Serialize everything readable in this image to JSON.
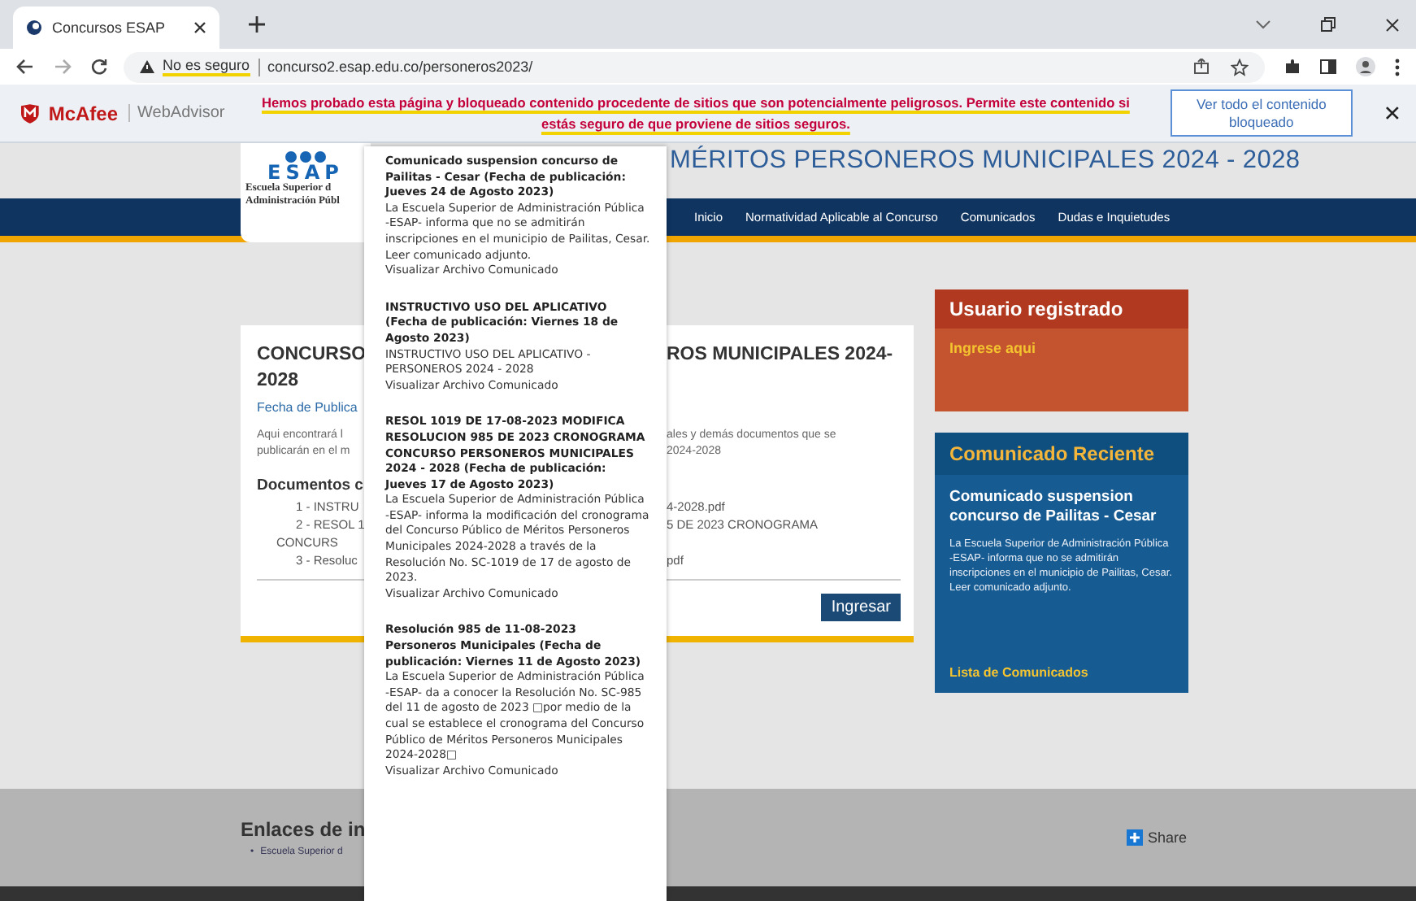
{
  "browser": {
    "tab": {
      "title": "Concursos ESAP"
    },
    "address": {
      "security": "No es seguro",
      "url": "concurso2.esap.edu.co/personeros2023/"
    }
  },
  "webadvisor": {
    "brand": "McAfee",
    "product": "WebAdvisor",
    "message": "Hemos probado esta página y bloqueado contenido procedente de sitios que son potencialmente peligrosos. Permite este contenido si estás seguro de que proviene de sitios seguros.",
    "button": "Ver todo el contenido bloqueado"
  },
  "header": {
    "logo_text": "ESAP",
    "logo_lines": [
      "Escuela Superior d",
      "Administración Públ"
    ],
    "title": "MÉRITOS PERSONEROS MUNICIPALES 2024 - 2028"
  },
  "nav": [
    "Inicio",
    "Normatividad Aplicable al Concurso",
    "Comunicados",
    "Dudas e Inquietudes"
  ],
  "main_card": {
    "title_left": "CONCURSO",
    "title_right": "ROS MUNICIPALES 2024-",
    "title_line2": "2028",
    "date": "Fecha de Publica",
    "intro": [
      {
        "left": "Aqui encontrará l",
        "right": "ales y demás documentos que se"
      },
      {
        "left": "publicarán en el m",
        "right": "2024-2028"
      }
    ],
    "documents_heading": "Documentos c",
    "documents": [
      {
        "left": "1 - INSTRU",
        "right": "4-2028.pdf"
      },
      {
        "left": "2 - RESOL 1",
        "right": "5 DE 2023 CRONOGRAMA"
      },
      {
        "left": "CONCURS"
      },
      {
        "left": "3 - Resoluc",
        "right": "pdf"
      }
    ],
    "button": "Ingresar"
  },
  "sidebar": {
    "user_box": {
      "title": "Usuario registrado",
      "link": "Ingrese aqui"
    },
    "recent_box": {
      "title": "Comunicado Reciente",
      "item_title": "Comunicado suspension concurso de Pailitas - Cesar",
      "item_text": "La Escuela Superior de Administración Pública -ESAP- informa que no se admitirán inscripciones en el municipio de Pailitas, Cesar. Leer comunicado adjunto.",
      "link": "Lista de Comunicados"
    }
  },
  "footer": {
    "heading": "Enlaces de in",
    "links": [
      {
        "bullet": "•",
        "label": "Escuela Superior d"
      }
    ],
    "share": "Share"
  },
  "popup": {
    "items": [
      {
        "title": "Comunicado suspension concurso de Pailitas - Cesar (Fecha de publicación: Jueves 24 de Agosto 2023)",
        "text": "La Escuela Superior de Administración Pública -ESAP- informa que no se admitirán inscripciones en el municipio de Pailitas, Cesar. Leer comunicado adjunto.",
        "link": "Visualizar Archivo Comunicado"
      },
      {
        "title": "INSTRUCTIVO USO DEL APLICATIVO (Fecha de publicación: Viernes 18 de Agosto 2023)",
        "text": "INSTRUCTIVO USO DEL APLICATIVO - PERSONEROS 2024 - 2028",
        "link": "Visualizar Archivo Comunicado"
      },
      {
        "title": "RESOL 1019 DE 17-08-2023 MODIFICA RESOLUCION 985 DE 2023 CRONOGRAMA CONCURSO PERSONEROS MUNICIPALES 2024 - 2028 (Fecha de publicación: Jueves 17 de Agosto 2023)",
        "text": "La Escuela Superior de Administración Pública -ESAP- informa la modificación del cronograma del Concurso Público de Méritos Personeros Municipales 2024-2028 a través de la Resolución No. SC-1019 de 17 de agosto de 2023.",
        "link": "Visualizar Archivo Comunicado"
      },
      {
        "title": "Resolución 985 de 11-08-2023 Personeros Municipales (Fecha de publicación: Viernes 11 de Agosto 2023)",
        "text": "La Escuela Superior de Administración Pública -ESAP- da a conocer la Resolución No. SC-985 del 11 de agosto de 2023 □por medio de la cual se establece el cronograma del Concurso Público de Méritos Personeros Municipales 2024-2028□",
        "link": "Visualizar Archivo Comunicado"
      }
    ]
  }
}
